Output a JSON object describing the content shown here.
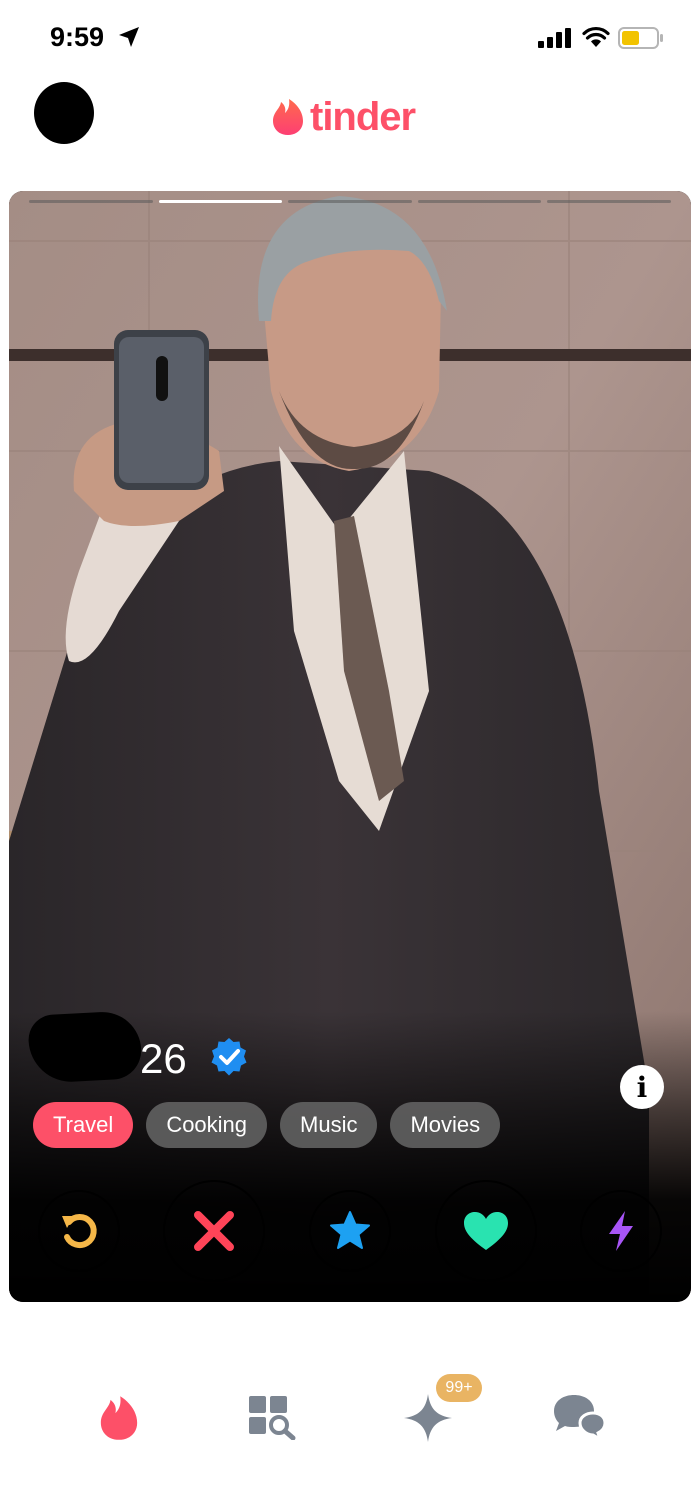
{
  "status_bar": {
    "time": "9:59",
    "icons": [
      "location-arrow-icon",
      "signal-icon",
      "wifi-icon",
      "battery-icon"
    ],
    "battery_color": "#f2c300"
  },
  "header": {
    "brand": "tinder",
    "brand_color": "#fd5068"
  },
  "profile": {
    "name": "",
    "age": "26",
    "verified": true,
    "photo_count": 5,
    "current_photo": 2,
    "interests": [
      {
        "label": "Travel",
        "highlighted": true
      },
      {
        "label": "Cooking",
        "highlighted": false
      },
      {
        "label": "Music",
        "highlighted": false
      },
      {
        "label": "Movies",
        "highlighted": false
      }
    ]
  },
  "actions": [
    {
      "name": "rewind",
      "icon": "rewind-icon",
      "color": "#f5b748"
    },
    {
      "name": "nope",
      "icon": "close-icon",
      "color": "#ff4458"
    },
    {
      "name": "super-like",
      "icon": "star-icon",
      "color": "#1da1f2"
    },
    {
      "name": "like",
      "icon": "heart-icon",
      "color": "#29e3b0"
    },
    {
      "name": "boost",
      "icon": "lightning-icon",
      "color": "#a855f7"
    }
  ],
  "bottom_nav": {
    "items": [
      "tinder-flame-icon",
      "explore-icon",
      "sparks-icon",
      "chat-icon"
    ],
    "sparks_badge": "99+",
    "active_color": "#fd5068",
    "inactive_color": "#7c8591"
  }
}
